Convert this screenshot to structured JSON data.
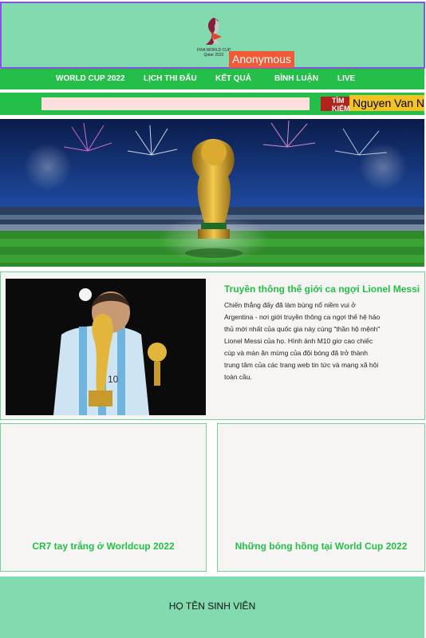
{
  "header": {
    "user_label": "Anonymous"
  },
  "nav": {
    "items": [
      {
        "label": "WORLD CUP 2022"
      },
      {
        "label": "LỊCH THI ĐẤU"
      },
      {
        "label": "KẾT QUẢ"
      },
      {
        "label": "BÌNH LUẬN"
      },
      {
        "label": "LIVE"
      }
    ]
  },
  "search": {
    "value": "",
    "button_label": "TÌM KIẾM",
    "student_name": "Nguyen Van N"
  },
  "feature": {
    "title": "Truyền thông thế giới ca ngợi Lionel Messi",
    "text": "Chiến thắng đấy đã làm bùng nổ niềm vui ở Argentina - nơi giới truyền thông ca ngợi thế hệ hảo thủ mới nhất của quốc gia này cùng \"thần hộ mệnh\" Lionel Messi của họ. Hình ảnh M10 giơ cao chiếc cúp và màn ăn mừng của đội bóng đã trở thành trung tâm của các trang web tin tức và mạng xã hội toàn cầu."
  },
  "cards": [
    {
      "title": "CR7 tay trắng  ở Worldcup 2022"
    },
    {
      "title": "Những bóng hồng tại World Cup 2022"
    }
  ],
  "footer": {
    "text": "HỌ TÊN SINH VIÊN"
  },
  "colors": {
    "header_bg": "#81dbaf",
    "nav_bg": "#23bf48",
    "badge": "#f05a37",
    "search_button": "#b3231e",
    "name_badge": "#f3c326"
  }
}
